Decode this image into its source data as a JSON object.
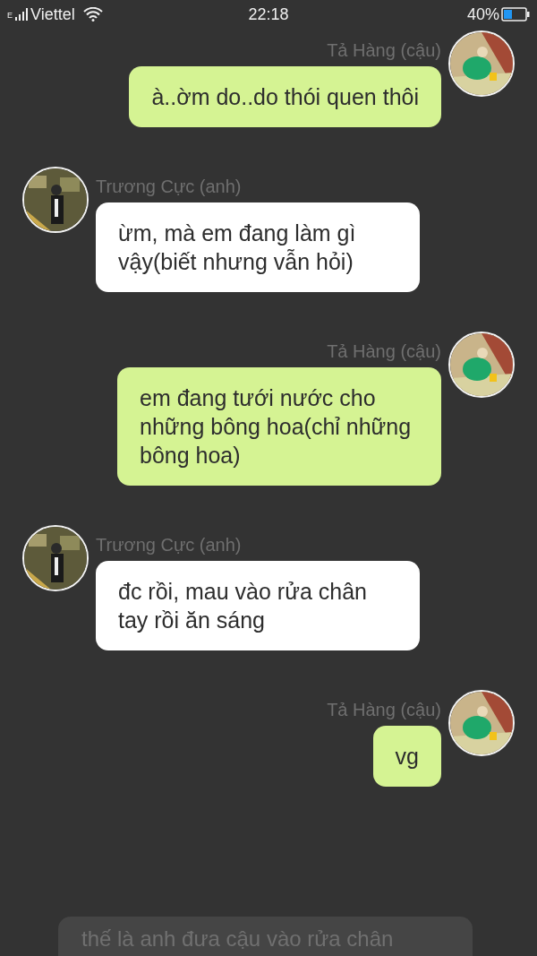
{
  "status_bar": {
    "carrier": "Viettel",
    "network": "E",
    "time": "22:18",
    "battery": "40%"
  },
  "messages": [
    {
      "kind": "outgoing",
      "sender": "Tả Hàng (cậu)",
      "text": "à..ờm do..do thói quen thôi"
    },
    {
      "kind": "incoming",
      "sender": "Trương Cực (anh)",
      "text": "ừm, mà em đang làm gì vậy(biết nhưng vẫn hỏi)"
    },
    {
      "kind": "outgoing",
      "sender": "Tả Hàng (cậu)",
      "text": "em đang tưới nước cho những bông hoa(chỉ những bông hoa)"
    },
    {
      "kind": "incoming",
      "sender": "Trương Cực (anh)",
      "text": "đc rồi, mau vào rửa chân tay rồi ăn sáng"
    },
    {
      "kind": "outgoing",
      "sender": "Tả Hàng (cậu)",
      "text": "vg"
    },
    {
      "kind": "draft",
      "text": "thế là anh đưa cậu vào rửa chân"
    }
  ]
}
